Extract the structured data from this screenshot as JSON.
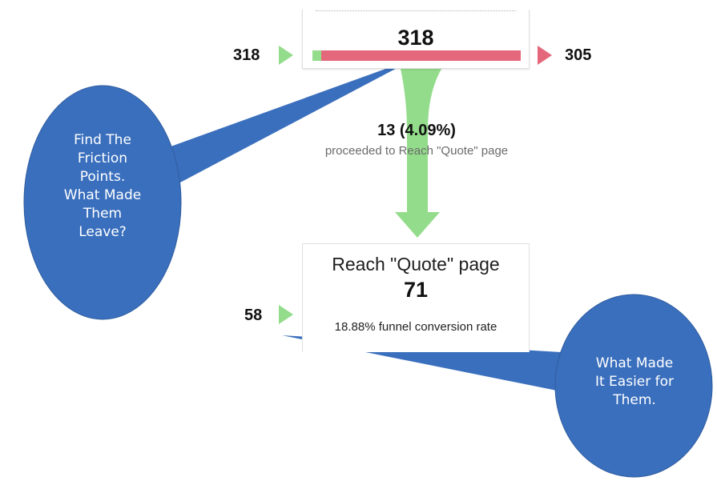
{
  "funnel": {
    "top_step": {
      "count": "318",
      "entered": "318",
      "exited": "305",
      "proceeded_fraction": 0.0409
    },
    "flow": {
      "count_label": "13 (4.09%)",
      "description": "proceeded to Reach \"Quote\" page"
    },
    "bottom_step": {
      "title": "Reach \"Quote\" page",
      "count": "71",
      "entered": "58",
      "conversion_label": "18.88% funnel conversion rate"
    }
  },
  "callouts": {
    "left": {
      "lines": [
        "Find The",
        "Friction",
        "Points.",
        "What Made",
        "Them",
        "Leave?"
      ]
    },
    "right": {
      "lines": [
        "What Made",
        "It Easier for",
        "Them."
      ]
    }
  },
  "colors": {
    "entry_green": "#93dc8b",
    "exit_red": "#e5677b",
    "callout_blue": "#3a6fbd"
  }
}
